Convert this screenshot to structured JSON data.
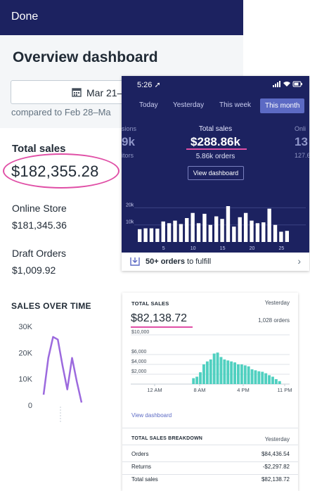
{
  "back": {
    "done_label": "Done",
    "title": "Overview dashboard",
    "date_range": "Mar 21–",
    "compare_text": "compared to Feb 28–Ma",
    "total_sales_label": "Total sales",
    "total_sales_value": "$182,355.28",
    "online_store_label": "Online Store",
    "online_store_value": "$181,345.36",
    "draft_orders_label": "Draft Orders",
    "draft_orders_value": "$1,009.92",
    "sales_over_time_label": "SALES OVER TIME",
    "chart_data": {
      "type": "line",
      "yticks": [
        "30K",
        "20K",
        "10K",
        "0"
      ],
      "ylim": [
        0,
        30000
      ],
      "values": [
        4000,
        18000,
        26000,
        25000,
        15000,
        6000,
        18000,
        9000,
        1000
      ],
      "color": "#9c6ade"
    }
  },
  "phone": {
    "time": "5:26",
    "tabs": [
      "Today",
      "Yesterday",
      "This week",
      "This month"
    ],
    "active_tab": "This month",
    "left_edge_top": "sions",
    "left_edge_value": "9k",
    "left_edge_bottom": "itors",
    "right_edge_top": "Onli",
    "right_edge_value": "13",
    "right_edge_bottom": "127.6",
    "total_sales_label": "Total sales",
    "total_sales_value": "$288.86k",
    "orders_text": "5.86k orders",
    "view_dashboard": "View dashboard",
    "fulfill_bold": "50+ orders",
    "fulfill_rest": " to fulfill",
    "chart_data": {
      "type": "bar",
      "yticks": [
        "20k",
        "10k"
      ],
      "xticks": [
        "5",
        "10",
        "15",
        "20",
        "25"
      ],
      "ylim": [
        0,
        28000
      ],
      "values": [
        7500,
        8000,
        8000,
        7800,
        12000,
        11000,
        12500,
        10500,
        14000,
        17000,
        11000,
        16500,
        10000,
        15000,
        13500,
        21000,
        9000,
        14500,
        17000,
        12500,
        11000,
        11500,
        19500,
        10000,
        6000,
        6500
      ],
      "color": "#ffffff"
    }
  },
  "card2": {
    "header": "TOTAL SALES",
    "period": "Yesterday",
    "value": "$82,138.72",
    "orders": "1,028 orders",
    "view_dashboard": "View dashboard",
    "breakdown_header": "TOTAL SALES BREAKDOWN",
    "breakdown_period": "Yesterday",
    "breakdown": [
      {
        "label": "Orders",
        "value": "$84,436.54"
      },
      {
        "label": "Returns",
        "value": "-$2,297.82"
      },
      {
        "label": "Total sales",
        "value": "$82,138.72"
      }
    ],
    "chart_data": {
      "type": "bar",
      "yticks": [
        "$10,000",
        "$6,000",
        "$4,000",
        "$2,000"
      ],
      "xticks": [
        "12 AM",
        "8 AM",
        "4 PM",
        "11 PM"
      ],
      "ylim": [
        0,
        10000
      ],
      "values": [
        0,
        0,
        0,
        0,
        0,
        0,
        0,
        0,
        0,
        0,
        0,
        0,
        1200,
        1500,
        2400,
        4000,
        4600,
        5000,
        6200,
        6400,
        5500,
        5000,
        4800,
        4600,
        4400,
        4000,
        4000,
        3800,
        3600,
        3000,
        2800,
        2600,
        2500,
        2200,
        1800,
        1500,
        1000,
        600,
        0,
        0
      ],
      "color": "#50d0c0"
    }
  }
}
